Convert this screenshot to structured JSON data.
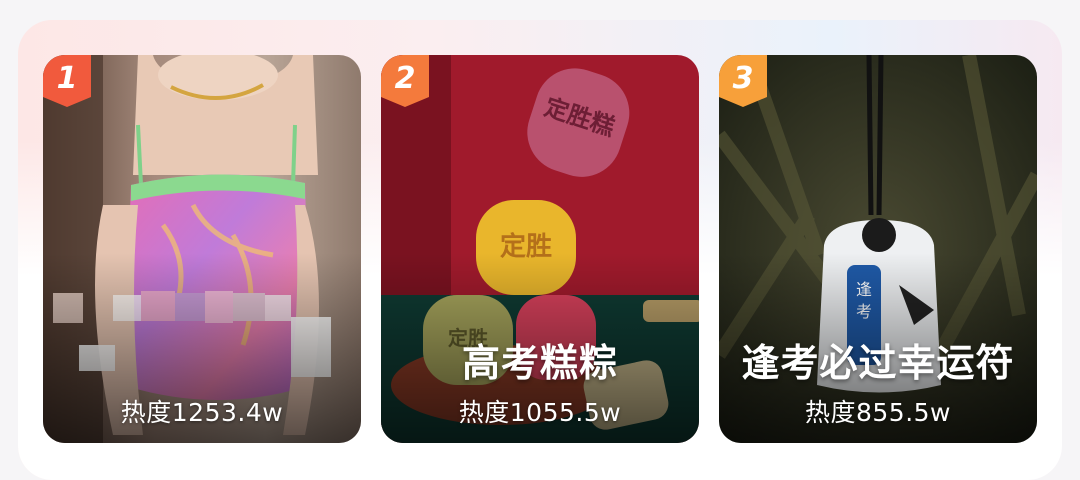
{
  "ranking": {
    "accent_colors": {
      "rank_badge": "#f15a3d",
      "rank_badge_light": "#f7a03a"
    },
    "items": [
      {
        "rank": "1",
        "title": "",
        "heat": "热度1253.4w",
        "title_obscured": true
      },
      {
        "rank": "2",
        "title": "高考糕粽",
        "heat": "热度1055.5w"
      },
      {
        "rank": "3",
        "title": "逢考必过幸运符",
        "heat": "热度855.5w"
      }
    ]
  }
}
